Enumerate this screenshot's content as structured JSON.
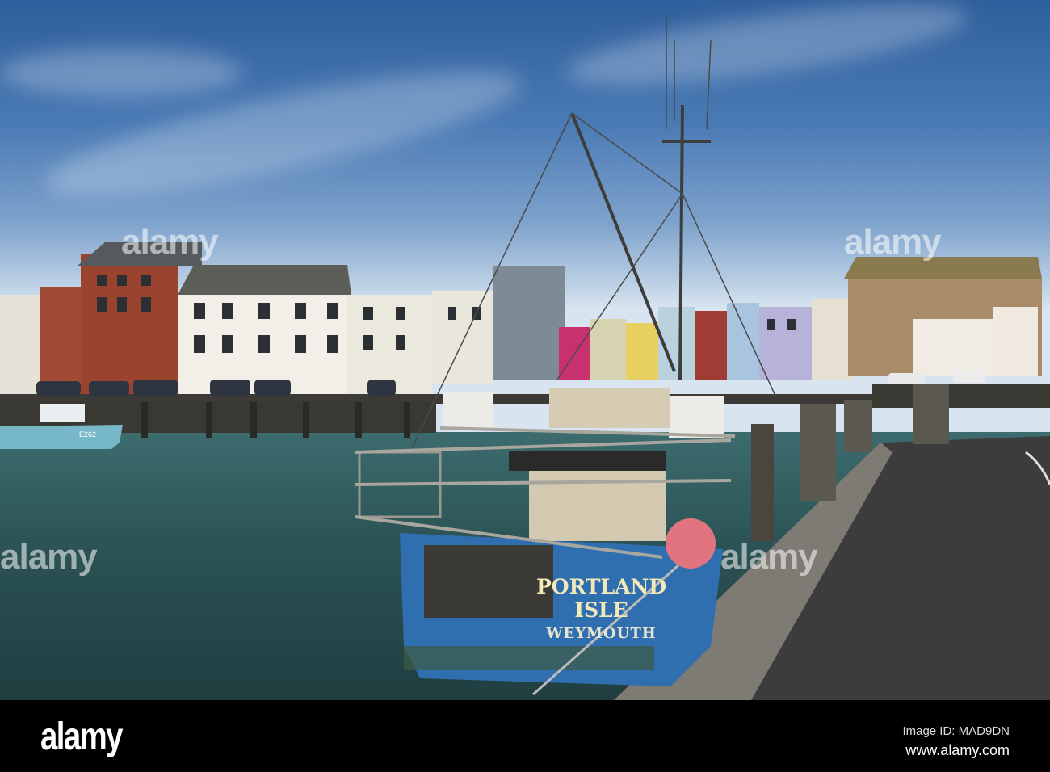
{
  "photo": {
    "boat_name_line1": "PORTLAND",
    "boat_name_line2": "ISLE",
    "boat_port": "WEYMOUTH",
    "small_boat_registration": "E262",
    "watermark": "alamy"
  },
  "footer": {
    "logo": "alamy",
    "image_id": "Image ID: MAD9DN",
    "url": "www.alamy.com"
  }
}
